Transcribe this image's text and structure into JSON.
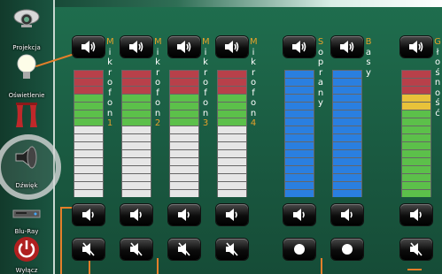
{
  "sidebar": {
    "items": [
      {
        "label": "Projekcja",
        "icon": "projector-icon"
      },
      {
        "label": "Oświetlenie",
        "icon": "lightbulb-icon"
      },
      {
        "label": "",
        "icon": "curtain-icon"
      },
      {
        "label": "Dźwięk",
        "icon": "speaker-icon",
        "active": true
      },
      {
        "label": "Blu-Ray",
        "icon": "bluray-player-icon"
      },
      {
        "label": "Wyłącz",
        "icon": "power-icon"
      }
    ]
  },
  "channels": [
    {
      "name": "Mikrofon",
      "number": "1",
      "meter": "mic",
      "bottom_icon": "mute-icon"
    },
    {
      "name": "Mikrofon",
      "number": "2",
      "meter": "mic",
      "bottom_icon": "mute-icon"
    },
    {
      "name": "Mikrofon",
      "number": "3",
      "meter": "mic",
      "bottom_icon": "mute-icon"
    },
    {
      "name": "Mikrofon",
      "number": "4",
      "meter": "mic",
      "bottom_icon": "mute-icon"
    },
    {
      "name": "Soprany",
      "number": "",
      "meter": "blue",
      "bottom_icon": "record-dot-icon"
    },
    {
      "name": "Basy",
      "number": "",
      "meter": "blue",
      "bottom_icon": "record-dot-icon"
    },
    {
      "name": "Głośność",
      "number": "",
      "meter": "master",
      "bottom_icon": "mute-icon"
    }
  ],
  "colors": {
    "accent": "#e57f2a",
    "meter_red": "#b8404a",
    "meter_green": "#5cc04a",
    "meter_gray": "#e6e6e6",
    "meter_blue": "#2a7fe0",
    "meter_yellow": "#e8c23a"
  }
}
